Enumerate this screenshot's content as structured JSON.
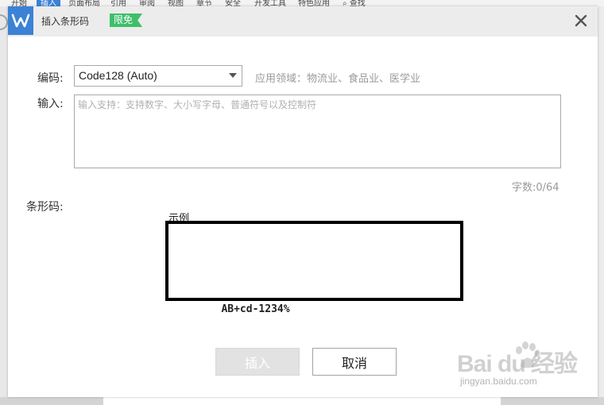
{
  "ribbon": {
    "tabs": [
      "开始",
      "插入",
      "页面布局",
      "引用",
      "审阅",
      "视图",
      "章节",
      "安全",
      "开发工具",
      "特色应用",
      "查找"
    ],
    "active_tab": "插入"
  },
  "dialog": {
    "title": "插入条形码",
    "badge": "限免",
    "encoding_label": "编码:",
    "encoding_value": "Code128 (Auto)",
    "encoding_hint": "应用领域：物流业、食品业、医学业",
    "input_label": "输入:",
    "input_value": "",
    "input_placeholder": "输入支持：支持数字、大小写字母、普通符号以及控制符",
    "char_count": "字数:0/64",
    "barcode_label": "条形码:",
    "example_label": "示例",
    "barcode_text": "AB+cd-1234%",
    "insert_button": "插入",
    "cancel_button": "取消"
  },
  "watermark": {
    "main": "Bai du 经验",
    "sub": "jingyan.baidu.com"
  },
  "colors": {
    "accent": "#3b82d6",
    "badge": "#3fbf6b"
  }
}
